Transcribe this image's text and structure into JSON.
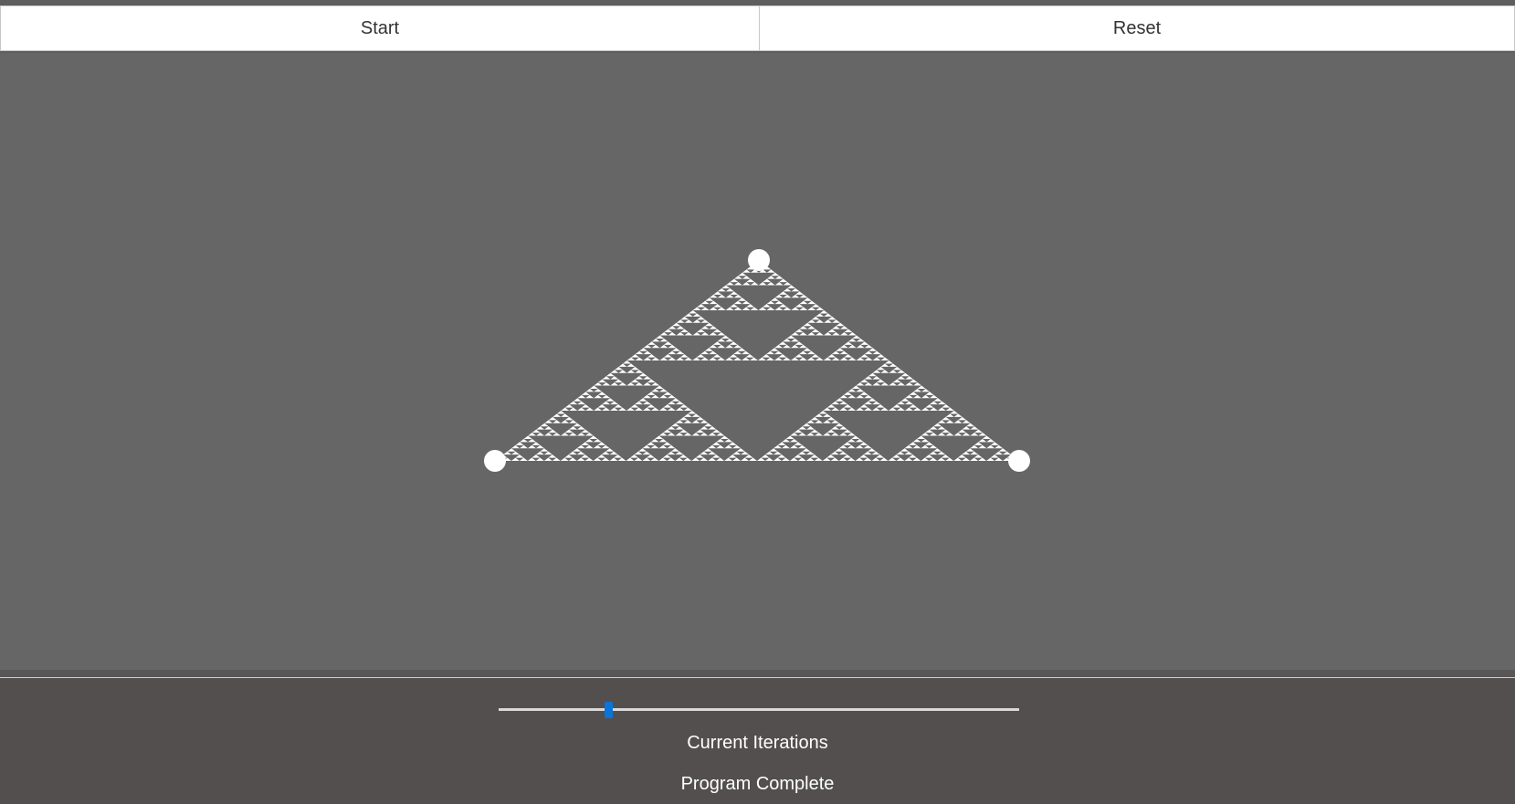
{
  "toolbar": {
    "start_label": "Start",
    "reset_label": "Reset"
  },
  "fractal": {
    "name": "Sierpinski triangle",
    "depth": 6,
    "background_color": "#666666",
    "foreground_color": "#ffffff"
  },
  "slider": {
    "fraction": 0.21
  },
  "status": {
    "iterations_label": "Current Iterations",
    "message": "Program Complete"
  },
  "colors": {
    "button_bg": "#ffffff",
    "button_text": "#333333",
    "panel_bg": "#534f4f",
    "slider_thumb": "#0a74da",
    "slider_track": "#d9d9d9"
  }
}
